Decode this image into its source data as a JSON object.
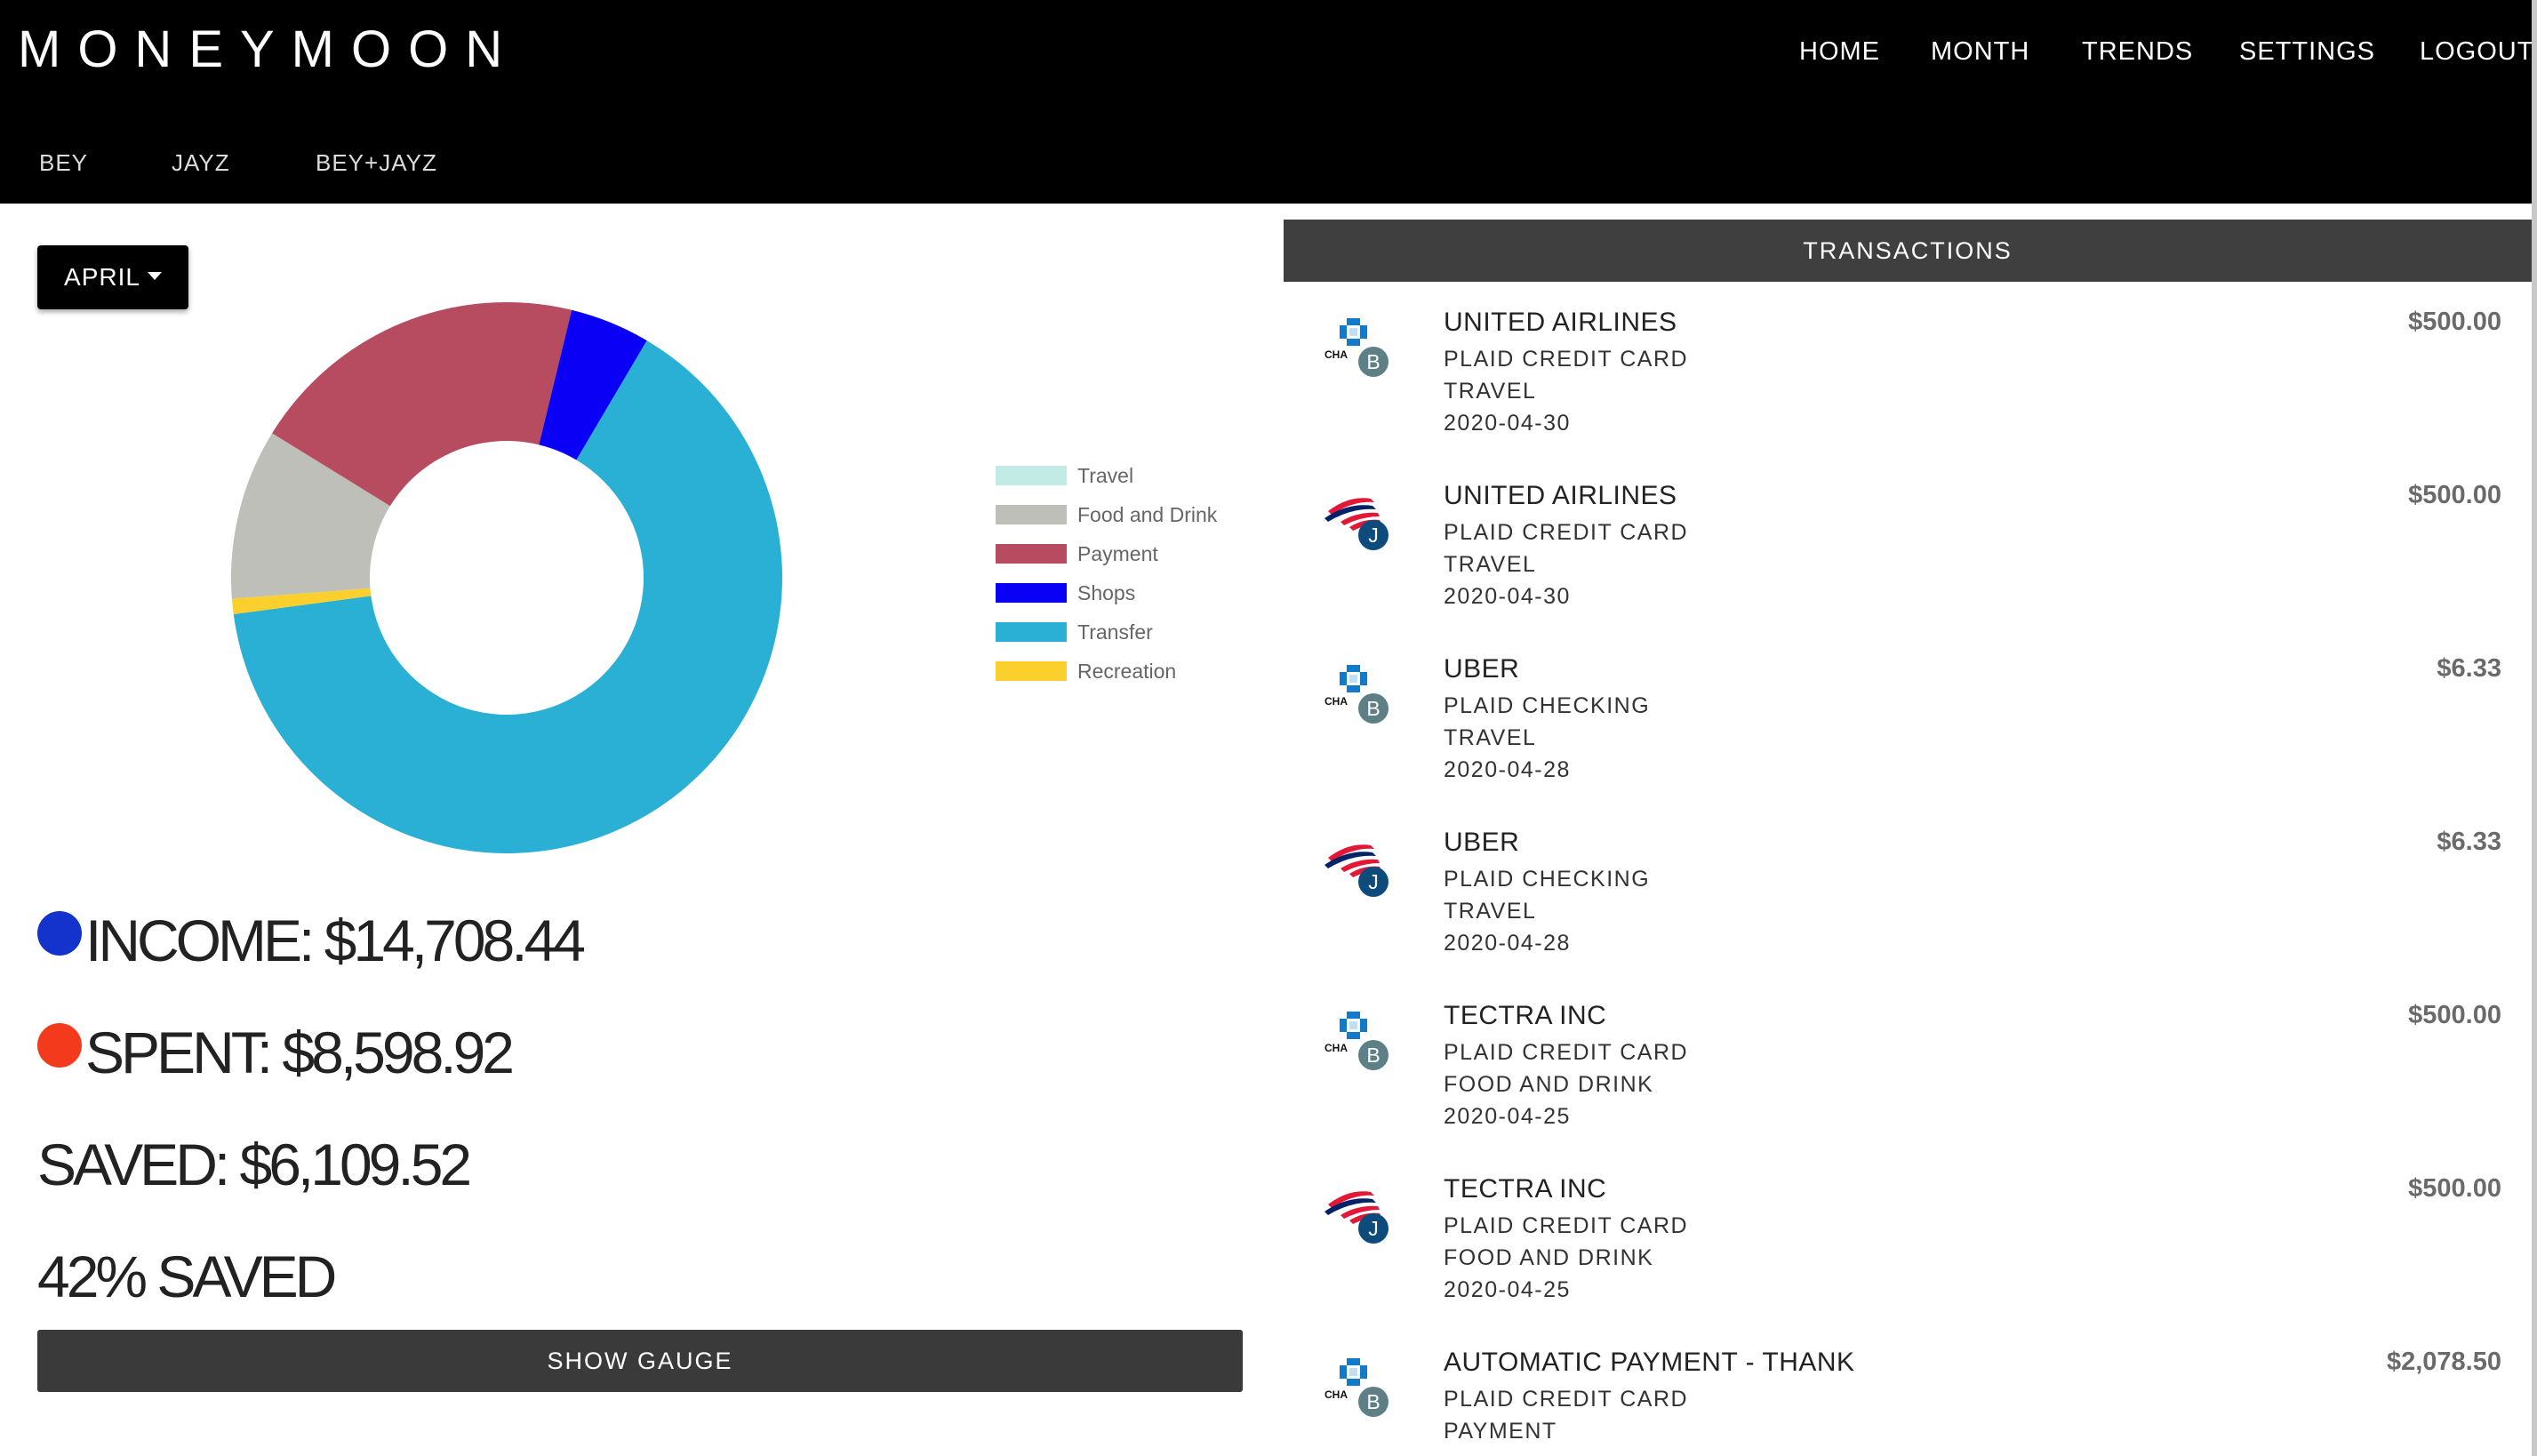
{
  "header": {
    "brand": "MONEYMOON",
    "nav": {
      "home": "HOME",
      "month": "MONTH",
      "trends": "TRENDS",
      "settings": "SETTINGS",
      "logout": "LOGOUT"
    },
    "tabs": {
      "bey": "BEY",
      "jayz": "JAYZ",
      "beyjayz": "BEY+JAYZ"
    }
  },
  "month_selector": {
    "label": "APRIL"
  },
  "chart_data": {
    "type": "pie",
    "style": "donut",
    "categories": [
      "Travel",
      "Food and Drink",
      "Payment",
      "Shops",
      "Transfer",
      "Recreation"
    ],
    "values": [
      0.0,
      10.0,
      20.0,
      4.7,
      64.4,
      0.9
    ],
    "colors": [
      "#c2ebe6",
      "#bdbfb8",
      "#b74c60",
      "#0a00f6",
      "#2aafd5",
      "#fbcf2c"
    ],
    "legend_position": "right"
  },
  "stats": {
    "income": "INCOME: $14,708.44",
    "income_color": "#1432cc",
    "spent": "SPENT: $8,598.92",
    "spent_color": "#f43a1c",
    "saved": "SAVED: $6,109.52",
    "saved_pct": "42% SAVED"
  },
  "gauge_button": "SHOW GAUGE",
  "transactions": {
    "title": "TRANSACTIONS",
    "items": [
      {
        "name": "UNITED AIRLINES",
        "account": "PLAID CREDIT CARD",
        "category": "TRAVEL",
        "date": "2020-04-30",
        "amount": "$500.00",
        "bank_icon": "chase-logo-icon",
        "owner": "B"
      },
      {
        "name": "UNITED AIRLINES",
        "account": "PLAID CREDIT CARD",
        "category": "TRAVEL",
        "date": "2020-04-30",
        "amount": "$500.00",
        "bank_icon": "bank-of-america-logo-icon",
        "owner": "J"
      },
      {
        "name": "UBER",
        "account": "PLAID CHECKING",
        "category": "TRAVEL",
        "date": "2020-04-28",
        "amount": "$6.33",
        "bank_icon": "chase-logo-icon",
        "owner": "B"
      },
      {
        "name": "UBER",
        "account": "PLAID CHECKING",
        "category": "TRAVEL",
        "date": "2020-04-28",
        "amount": "$6.33",
        "bank_icon": "bank-of-america-logo-icon",
        "owner": "J"
      },
      {
        "name": "TECTRA INC",
        "account": "PLAID CREDIT CARD",
        "category": "FOOD AND DRINK",
        "date": "2020-04-25",
        "amount": "$500.00",
        "bank_icon": "chase-logo-icon",
        "owner": "B"
      },
      {
        "name": "TECTRA INC",
        "account": "PLAID CREDIT CARD",
        "category": "FOOD AND DRINK",
        "date": "2020-04-25",
        "amount": "$500.00",
        "bank_icon": "bank-of-america-logo-icon",
        "owner": "J"
      },
      {
        "name": "AUTOMATIC PAYMENT - THANK",
        "account": "PLAID CREDIT CARD",
        "category": "PAYMENT",
        "date": "",
        "amount": "$2,078.50",
        "bank_icon": "chase-logo-icon",
        "owner": "B"
      }
    ]
  }
}
